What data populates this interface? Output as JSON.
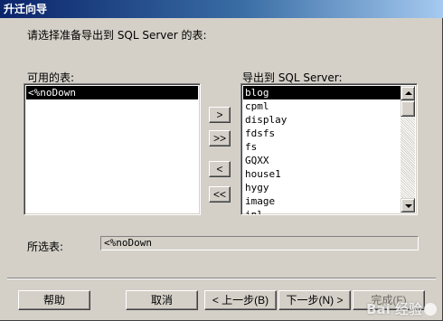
{
  "window": {
    "title": "升迁向导"
  },
  "instruction": "请选择准备导出到 SQL Server 的表:",
  "available": {
    "label": "可用的表:",
    "items": [
      "<%noDown"
    ],
    "selected_index": 0
  },
  "export": {
    "label": "导出到 SQL Server:",
    "items": [
      "blog",
      "cpml",
      "display",
      "fdsfs",
      "fs",
      "GQXX",
      "house1",
      "hygy",
      "image",
      "inl"
    ],
    "selected_index": 0
  },
  "move_buttons": {
    "add": ">",
    "add_all": ">>",
    "remove": "<",
    "remove_all": "<<"
  },
  "selected": {
    "label": "所选表:",
    "value": "<%noDown"
  },
  "footer": {
    "help": "帮助",
    "cancel": "取消",
    "back": "< 上一步(B)",
    "next": "下一步(N) >",
    "finish": "完成(F)"
  },
  "watermark": "Bai 经验"
}
